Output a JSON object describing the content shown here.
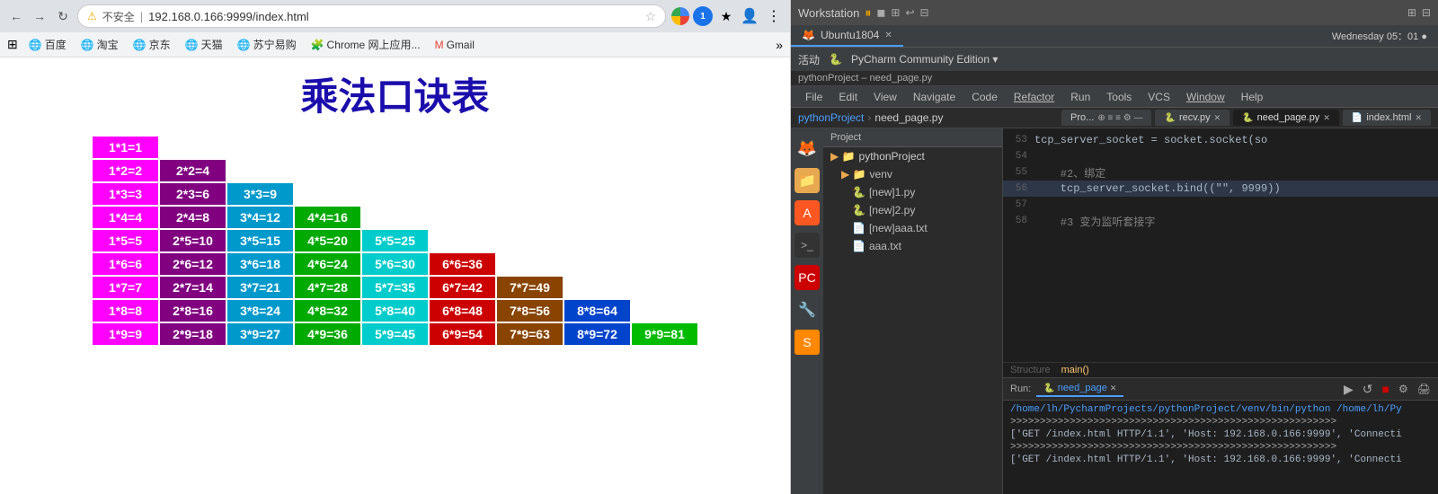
{
  "browser": {
    "address": "192.168.0.166:9999/index.html",
    "warning_text": "不安全",
    "page_title": "乘法口诀表",
    "bookmarks": [
      {
        "label": "应用",
        "icon": "⚡"
      },
      {
        "label": "百度",
        "icon": "🌐"
      },
      {
        "label": "淘宝",
        "icon": "🌐"
      },
      {
        "label": "京东",
        "icon": "🌐"
      },
      {
        "label": "天猫",
        "icon": "🌐"
      },
      {
        "label": "苏宁易购",
        "icon": "🌐"
      },
      {
        "label": "Chrome 网上应用...",
        "icon": "🧩"
      },
      {
        "label": "Gmail",
        "icon": "✉"
      }
    ],
    "table": {
      "rows": [
        [
          {
            "text": "1*1=1",
            "bg": "#ff00ff"
          }
        ],
        [
          {
            "text": "1*2=2",
            "bg": "#ff00ff"
          },
          {
            "text": "2*2=4",
            "bg": "#800080"
          }
        ],
        [
          {
            "text": "1*3=3",
            "bg": "#ff00ff"
          },
          {
            "text": "2*3=6",
            "bg": "#800080"
          },
          {
            "text": "3*3=9",
            "bg": "#0099cc"
          }
        ],
        [
          {
            "text": "1*4=4",
            "bg": "#ff00ff"
          },
          {
            "text": "2*4=8",
            "bg": "#800080"
          },
          {
            "text": "3*4=12",
            "bg": "#0099cc"
          },
          {
            "text": "4*4=16",
            "bg": "#00aa00"
          }
        ],
        [
          {
            "text": "1*5=5",
            "bg": "#ff00ff"
          },
          {
            "text": "2*5=10",
            "bg": "#800080"
          },
          {
            "text": "3*5=15",
            "bg": "#0099cc"
          },
          {
            "text": "4*5=20",
            "bg": "#00aa00"
          },
          {
            "text": "5*5=25",
            "bg": "#00cccc"
          }
        ],
        [
          {
            "text": "1*6=6",
            "bg": "#ff00ff"
          },
          {
            "text": "2*6=12",
            "bg": "#800080"
          },
          {
            "text": "3*6=18",
            "bg": "#0099cc"
          },
          {
            "text": "4*6=24",
            "bg": "#00aa00"
          },
          {
            "text": "5*6=30",
            "bg": "#00cccc"
          },
          {
            "text": "6*6=36",
            "bg": "#cc0000"
          }
        ],
        [
          {
            "text": "1*7=7",
            "bg": "#ff00ff"
          },
          {
            "text": "2*7=14",
            "bg": "#800080"
          },
          {
            "text": "3*7=21",
            "bg": "#0099cc"
          },
          {
            "text": "4*7=28",
            "bg": "#00aa00"
          },
          {
            "text": "5*7=35",
            "bg": "#00cccc"
          },
          {
            "text": "6*7=42",
            "bg": "#cc0000"
          },
          {
            "text": "7*7=49",
            "bg": "#884400"
          }
        ],
        [
          {
            "text": "1*8=8",
            "bg": "#ff00ff"
          },
          {
            "text": "2*8=16",
            "bg": "#800080"
          },
          {
            "text": "3*8=24",
            "bg": "#0099cc"
          },
          {
            "text": "4*8=32",
            "bg": "#00aa00"
          },
          {
            "text": "5*8=40",
            "bg": "#00cccc"
          },
          {
            "text": "6*8=48",
            "bg": "#cc0000"
          },
          {
            "text": "7*8=56",
            "bg": "#884400"
          },
          {
            "text": "8*8=64",
            "bg": "#0044cc"
          }
        ],
        [
          {
            "text": "1*9=9",
            "bg": "#ff00ff"
          },
          {
            "text": "2*9=18",
            "bg": "#800080"
          },
          {
            "text": "3*9=27",
            "bg": "#0099cc"
          },
          {
            "text": "4*9=36",
            "bg": "#00aa00"
          },
          {
            "text": "5*9=45",
            "bg": "#00cccc"
          },
          {
            "text": "6*9=54",
            "bg": "#cc0000"
          },
          {
            "text": "7*9=63",
            "bg": "#884400"
          },
          {
            "text": "8*9=72",
            "bg": "#0044cc"
          },
          {
            "text": "9*9=81",
            "bg": "#00bb00"
          }
        ]
      ]
    }
  },
  "pycharm": {
    "workstation": "Workstation",
    "ubuntu_tab": "Ubuntu1804",
    "datetime": "Wednesday 05：01 ●",
    "project_title": "pythonProject – need_page.py",
    "menu": {
      "items": [
        "File",
        "Edit",
        "View",
        "Navigate",
        "Code",
        "Refactor",
        "Run",
        "Tools",
        "VCS",
        "Window",
        "Help"
      ]
    },
    "breadcrumb": {
      "project": "pythonProject",
      "file": "need_page.py"
    },
    "tabs": {
      "project_label": "Pro...",
      "tab1": "recv.py",
      "tab2": "need_page.py",
      "tab3": "index.html"
    },
    "tree": {
      "root": "pythonProject",
      "items": [
        {
          "label": "venv",
          "type": "folder",
          "indent": 1
        },
        {
          "label": "[new]1.py",
          "type": "py",
          "indent": 2
        },
        {
          "label": "[new]2.py",
          "type": "py",
          "indent": 2
        },
        {
          "label": "[new]aaa.txt",
          "type": "txt",
          "indent": 2
        },
        {
          "label": "aaa.txt",
          "type": "txt",
          "indent": 2
        }
      ]
    },
    "code_lines": [
      {
        "num": "53",
        "text": "tcp_server_socket = socket.socket(so",
        "type": "normal"
      },
      {
        "num": "54",
        "text": "",
        "type": "normal"
      },
      {
        "num": "55",
        "text": "    #2、绑定",
        "type": "comment"
      },
      {
        "num": "56",
        "text": "    tcp_server_socket.bind((\"\", 9999))",
        "type": "highlight"
      },
      {
        "num": "57",
        "text": "",
        "type": "normal"
      },
      {
        "num": "58",
        "text": "    #3  变为监听套接字",
        "type": "comment"
      }
    ],
    "structure": {
      "label": "Structure",
      "main_func": "main()"
    },
    "run": {
      "tab_label": "need_page",
      "lines": [
        "/home/lh/PycharmProjects/pythonProject/venv/bin/python /home/lh/Py",
        ">>>>>>>>>>>>>>>>>>>>>>>>>>>>>>>>>>>>>>>>>>>>>>>>>>>>>>>",
        "['GET /index.html HTTP/1.1', 'Host: 192.168.0.166:9999', 'Connecti",
        ">>>>>>>>>>>>>>>>>>>>>>>>>>>>>>>>>>>>>>>>>>>>>>>>>>>>>>>",
        "['GET /index.html HTTP/1.1', 'Host: 192.168.0.166:9999', 'Connecti"
      ]
    },
    "run_controls": {
      "play": "▶",
      "reload": "↺",
      "stop": "■",
      "settings": "⚙"
    }
  }
}
